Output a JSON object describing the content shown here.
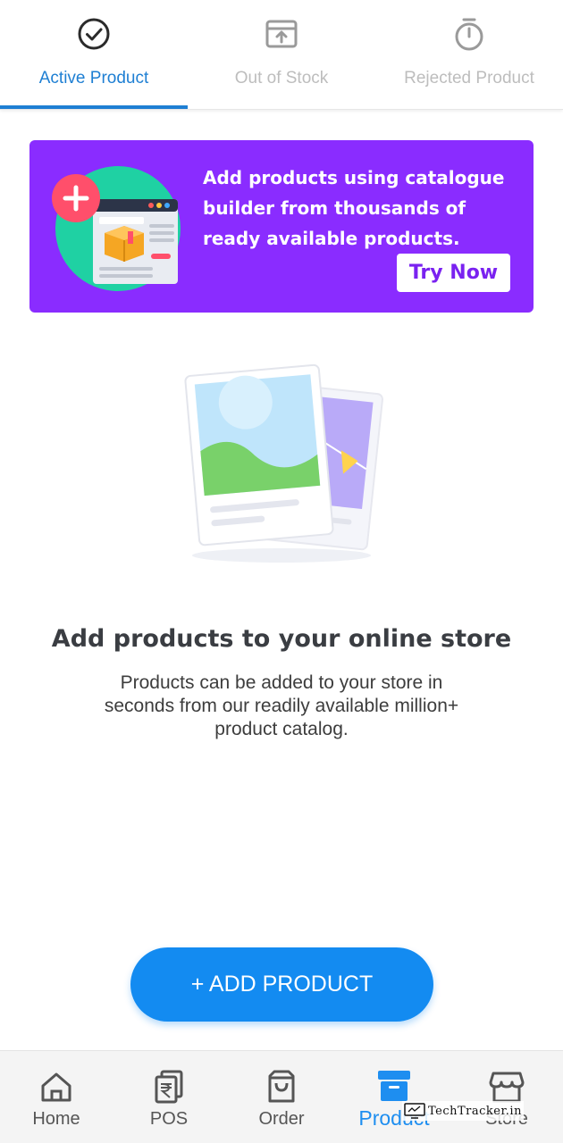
{
  "tabs": [
    {
      "label": "Active Product",
      "icon": "check-circle-icon",
      "active": true
    },
    {
      "label": "Out of Stock",
      "icon": "box-upload-icon",
      "active": false
    },
    {
      "label": "Rejected Product",
      "icon": "stopwatch-icon",
      "active": false
    }
  ],
  "banner": {
    "text": "Add products using catalogue builder from thousands of ready available products.",
    "button_label": "Try Now",
    "background": "#8a2cff"
  },
  "empty_state": {
    "title": "Add products to your online store",
    "description": "Products can be added to your store in seconds from our readily available million+ product catalog."
  },
  "add_button": {
    "label": "+ ADD PRODUCT",
    "color": "#138bf1"
  },
  "bottom_nav": [
    {
      "label": "Home",
      "icon": "home-icon",
      "active": false
    },
    {
      "label": "POS",
      "icon": "pos-rupee-icon",
      "active": false
    },
    {
      "label": "Order",
      "icon": "order-bag-icon",
      "active": false
    },
    {
      "label": "Product",
      "icon": "product-box-icon",
      "active": true
    },
    {
      "label": "Store",
      "icon": "store-icon",
      "active": false
    }
  ],
  "watermark": {
    "text": "TechTracker.in"
  },
  "colors": {
    "accent": "#1e7fd3",
    "inactive": "#bdbdbd"
  }
}
